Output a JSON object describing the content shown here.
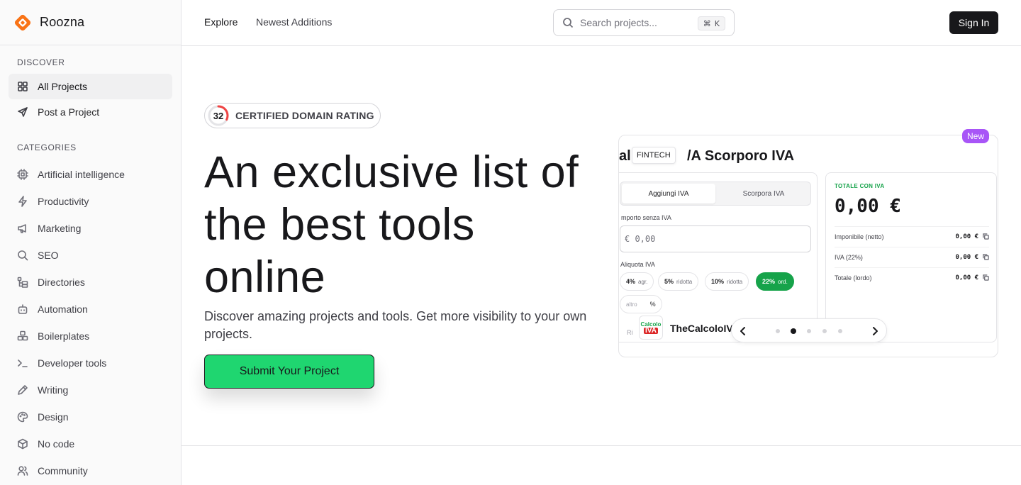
{
  "brand": {
    "name": "Roozna"
  },
  "sidebar": {
    "discover_title": "DISCOVER",
    "discover_items": [
      {
        "label": "All Projects",
        "icon": "grid-icon",
        "active": true
      },
      {
        "label": "Post a Project",
        "icon": "send-icon",
        "active": false
      }
    ],
    "categories_title": "CATEGORIES",
    "categories": [
      {
        "label": "Artificial intelligence",
        "icon": "cpu-icon"
      },
      {
        "label": "Productivity",
        "icon": "zap-icon"
      },
      {
        "label": "Marketing",
        "icon": "megaphone-icon"
      },
      {
        "label": "SEO",
        "icon": "search-icon"
      },
      {
        "label": "Directories",
        "icon": "folder-tree-icon"
      },
      {
        "label": "Automation",
        "icon": "bot-icon"
      },
      {
        "label": "Boilerplates",
        "icon": "boxes-icon"
      },
      {
        "label": "Developer tools",
        "icon": "terminal-icon"
      },
      {
        "label": "Writing",
        "icon": "pen-icon"
      },
      {
        "label": "Design",
        "icon": "palette-icon"
      },
      {
        "label": "No code",
        "icon": "package-icon"
      },
      {
        "label": "Community",
        "icon": "users-icon"
      }
    ]
  },
  "topbar": {
    "explore": "Explore",
    "newest": "Newest Additions",
    "search_placeholder": "Search projects...",
    "shortcut_symbol": "⌘",
    "shortcut_key": "K",
    "signin": "Sign In"
  },
  "hero": {
    "rating_value": "32",
    "rating_fraction": 0.32,
    "rating_label": "CERTIFIED DOMAIN RATING",
    "title": "An exclusive list of the best tools online",
    "subtitle": "Discover amazing projects and tools. Get more visibility to your own projects.",
    "cta": "Submit Your Project"
  },
  "preview": {
    "badge": "New",
    "title_pre": "al",
    "title_post": "/A Scorporo IVA",
    "category": "FINTECH",
    "tab_add": "Aggiungi IVA",
    "tab_remove": "Scorpora IVA",
    "amount_label": "mporto senza IVA",
    "amount_placeholder": "€ 0,00",
    "rate_label": "Aliquota IVA",
    "rates": [
      {
        "value": "4%",
        "sub": "agr.",
        "selected": false
      },
      {
        "value": "5%",
        "sub": "ridotta",
        "selected": false
      },
      {
        "value": "10%",
        "sub": "ridotta",
        "selected": false
      },
      {
        "value": "22%",
        "sub": "ord.",
        "selected": true
      }
    ],
    "rate_other": "altro",
    "rate_other_unit": "%",
    "rate_cut_label": "Ri",
    "total_label": "TOTALE CON IVA",
    "total_value": "0,00 €",
    "rows": [
      {
        "label": "Imponibile (netto)",
        "value": "0,00 €"
      },
      {
        "label": "IVA (22%)",
        "value": "0,00 €"
      },
      {
        "label": "Totale (lordo)",
        "value": "0,00 €"
      }
    ],
    "tool_logo_line1": "Calcolo",
    "tool_logo_line2": "IVA",
    "tool_name": "TheCalcoloIV",
    "pager_active_index": 1,
    "pager_count": 5
  }
}
